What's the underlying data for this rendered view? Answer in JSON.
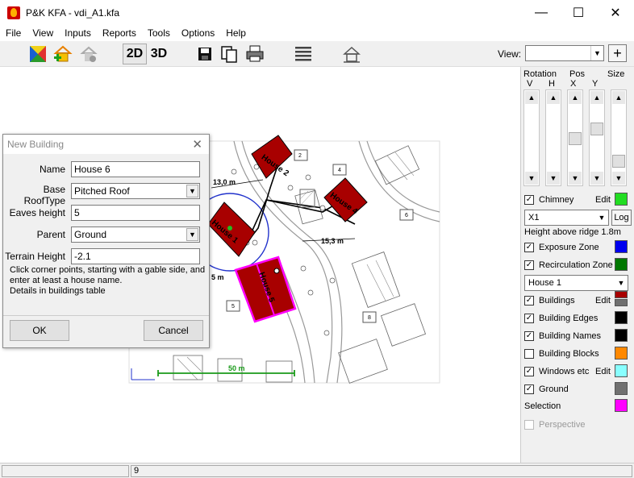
{
  "window": {
    "title": "P&K KFA - vdi_A1.kfa"
  },
  "menu": [
    "File",
    "View",
    "Inputs",
    "Reports",
    "Tools",
    "Options",
    "Help"
  ],
  "toolbar": {
    "btn_2d": "2D",
    "btn_3d": "3D",
    "view_label": "View:",
    "view_value": "",
    "plus_label": "+"
  },
  "dialog": {
    "title": "New Building",
    "name_label": "Name",
    "name_value": "House 6",
    "roof_label": "Base RoofType",
    "roof_value": "Pitched Roof",
    "eaves_label": "Eaves height",
    "eaves_value": "5",
    "parent_label": "Parent",
    "parent_value": "Ground",
    "terrain_label": "Terrain Height",
    "terrain_value": "-2.1",
    "help_line1": "Click corner points, starting with a gable side, and",
    "help_line2": "enter at least a house name.",
    "help_line3": "Details in buildings table",
    "ok": "OK",
    "cancel": "Cancel"
  },
  "map": {
    "labels": {
      "house1": "House 1",
      "house2": "House 2",
      "house4": "House 4",
      "house5": "House 5",
      "d1": "13,0 m",
      "d2": "15,3 m",
      "d3": "5 m",
      "scale": "50 m",
      "n2": "2",
      "n4": "4",
      "n5": "5",
      "n6": "6",
      "n8": "8"
    }
  },
  "panel": {
    "rotation": "Rotation",
    "v": "V",
    "h": "H",
    "pos": "Pos",
    "x": "X",
    "y": "Y",
    "size": "Size",
    "chimney": "Chimney",
    "chimney_edit": "Edit",
    "chimney_color": "#22dd22",
    "x1_value": "X1",
    "log": "Log",
    "ridge_text": "Height above ridge 1.8m",
    "exposure": "Exposure Zone",
    "exposure_color": "#0000ee",
    "recirc": "Recirculation Zone",
    "recirc_color": "#007700",
    "house_select": "House 1",
    "buildings": "Buildings",
    "buildings_edit": "Edit",
    "edges": "Building Edges",
    "edges_color": "#000000",
    "names": "Building Names",
    "names_color": "#000000",
    "blocks": "Building Blocks",
    "blocks_color": "#ff8800",
    "windows": "Windows etc",
    "windows_edit": "Edit",
    "windows_color": "#88ffff",
    "ground": "Ground",
    "ground_color": "#707070",
    "selection": "Selection",
    "selection_color": "#ff00ff",
    "perspective": "Perspective"
  },
  "status": {
    "cell2": "9"
  }
}
